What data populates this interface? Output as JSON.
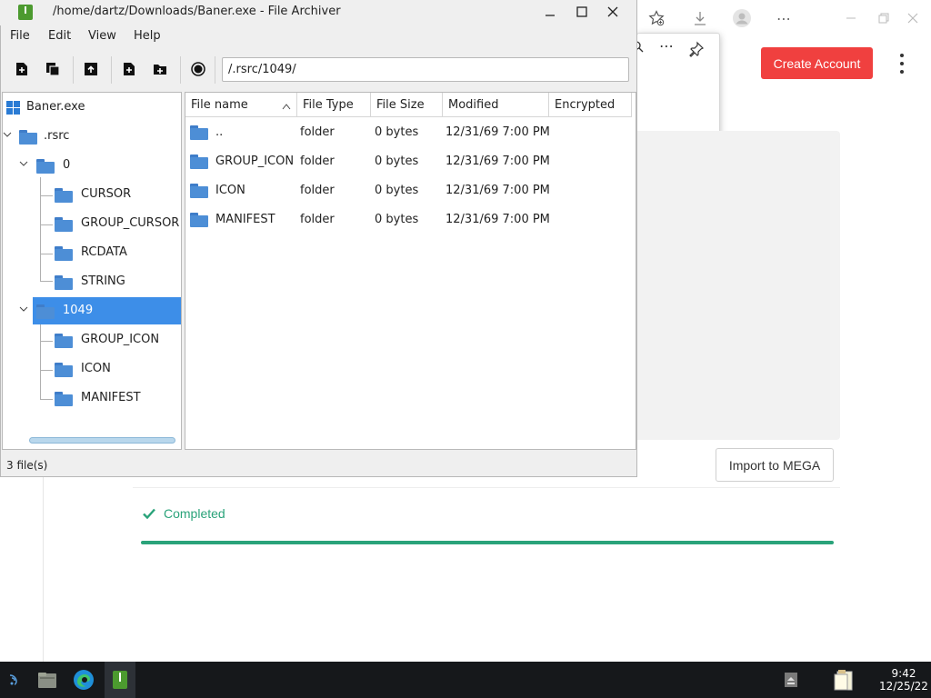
{
  "browser": {
    "create_account": "Create Account",
    "import_button": "Import to MEGA",
    "status_text": "Completed",
    "progress": 1.0,
    "accent": "#f0403f",
    "success": "#2aa37a"
  },
  "window": {
    "title": "/home/dartz/Downloads/Baner.exe - File Archiver",
    "menu": [
      "File",
      "Edit",
      "View",
      "Help"
    ],
    "path": "/.rsrc/1049/",
    "status": "3 file(s)"
  },
  "tree": {
    "root": "Baner.exe",
    "rsrc": ".rsrc",
    "folder0": "0",
    "folder0_children": [
      "CURSOR",
      "GROUP_CURSOR",
      "RCDATA",
      "STRING"
    ],
    "folder1049": "1049",
    "folder1049_children": [
      "GROUP_ICON",
      "ICON",
      "MANIFEST"
    ]
  },
  "columns": [
    "File name",
    "File Type",
    "File Size",
    "Modified",
    "Encrypted"
  ],
  "files": [
    {
      "name": "..",
      "type": "folder",
      "size": "0 bytes",
      "modified": "12/31/69 7:00 PM",
      "encrypted": ""
    },
    {
      "name": "GROUP_ICON",
      "type": "folder",
      "size": "0 bytes",
      "modified": "12/31/69 7:00 PM",
      "encrypted": ""
    },
    {
      "name": "ICON",
      "type": "folder",
      "size": "0 bytes",
      "modified": "12/31/69 7:00 PM",
      "encrypted": ""
    },
    {
      "name": "MANIFEST",
      "type": "folder",
      "size": "0 bytes",
      "modified": "12/31/69 7:00 PM",
      "encrypted": ""
    }
  ],
  "taskbar": {
    "time": "9:42",
    "date": "12/25/22"
  }
}
